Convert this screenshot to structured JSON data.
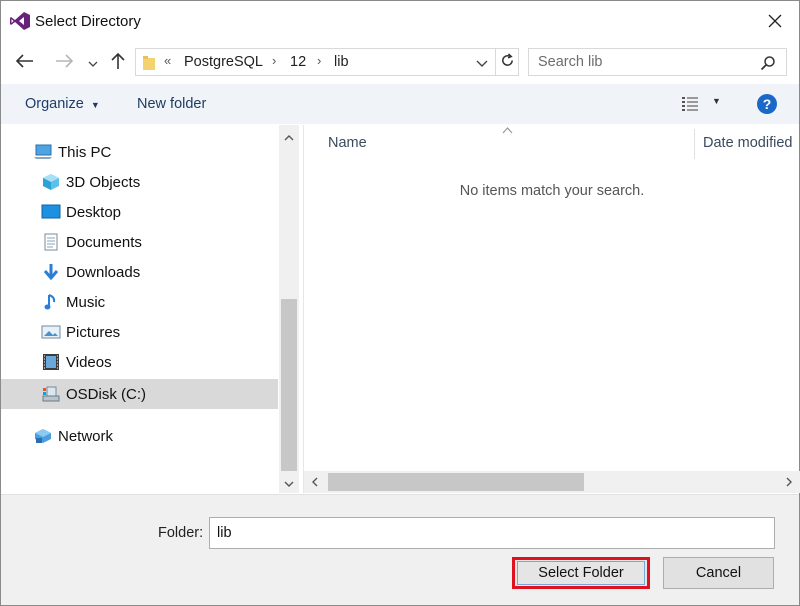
{
  "window": {
    "title": "Select Directory"
  },
  "address": {
    "overflow": "«",
    "crumbs": [
      "PostgreSQL",
      "12",
      "lib"
    ],
    "separator": "›"
  },
  "search": {
    "placeholder": "Search lib"
  },
  "commands": {
    "organize": "Organize",
    "new_folder": "New folder"
  },
  "nav": {
    "items": [
      {
        "label": "This PC",
        "icon": "pc-icon"
      },
      {
        "label": "3D Objects",
        "icon": "3d-objects-icon"
      },
      {
        "label": "Desktop",
        "icon": "desktop-icon"
      },
      {
        "label": "Documents",
        "icon": "documents-icon"
      },
      {
        "label": "Downloads",
        "icon": "downloads-icon"
      },
      {
        "label": "Music",
        "icon": "music-icon"
      },
      {
        "label": "Pictures",
        "icon": "pictures-icon"
      },
      {
        "label": "Videos",
        "icon": "videos-icon"
      },
      {
        "label": "OSDisk (C:)",
        "icon": "drive-icon",
        "selected": true
      },
      {
        "label": "Network",
        "icon": "network-icon"
      }
    ]
  },
  "content": {
    "columns": [
      "Name",
      "Date modified"
    ],
    "empty_message": "No items match your search."
  },
  "footer": {
    "folder_label": "Folder:",
    "folder_value": "lib",
    "select_button": "Select Folder",
    "cancel_button": "Cancel"
  },
  "colors": {
    "accent": "#1b68c8",
    "highlight_border": "#e0101e",
    "selected_bg": "#d9d9d9",
    "vs_purple": "#68217a"
  }
}
